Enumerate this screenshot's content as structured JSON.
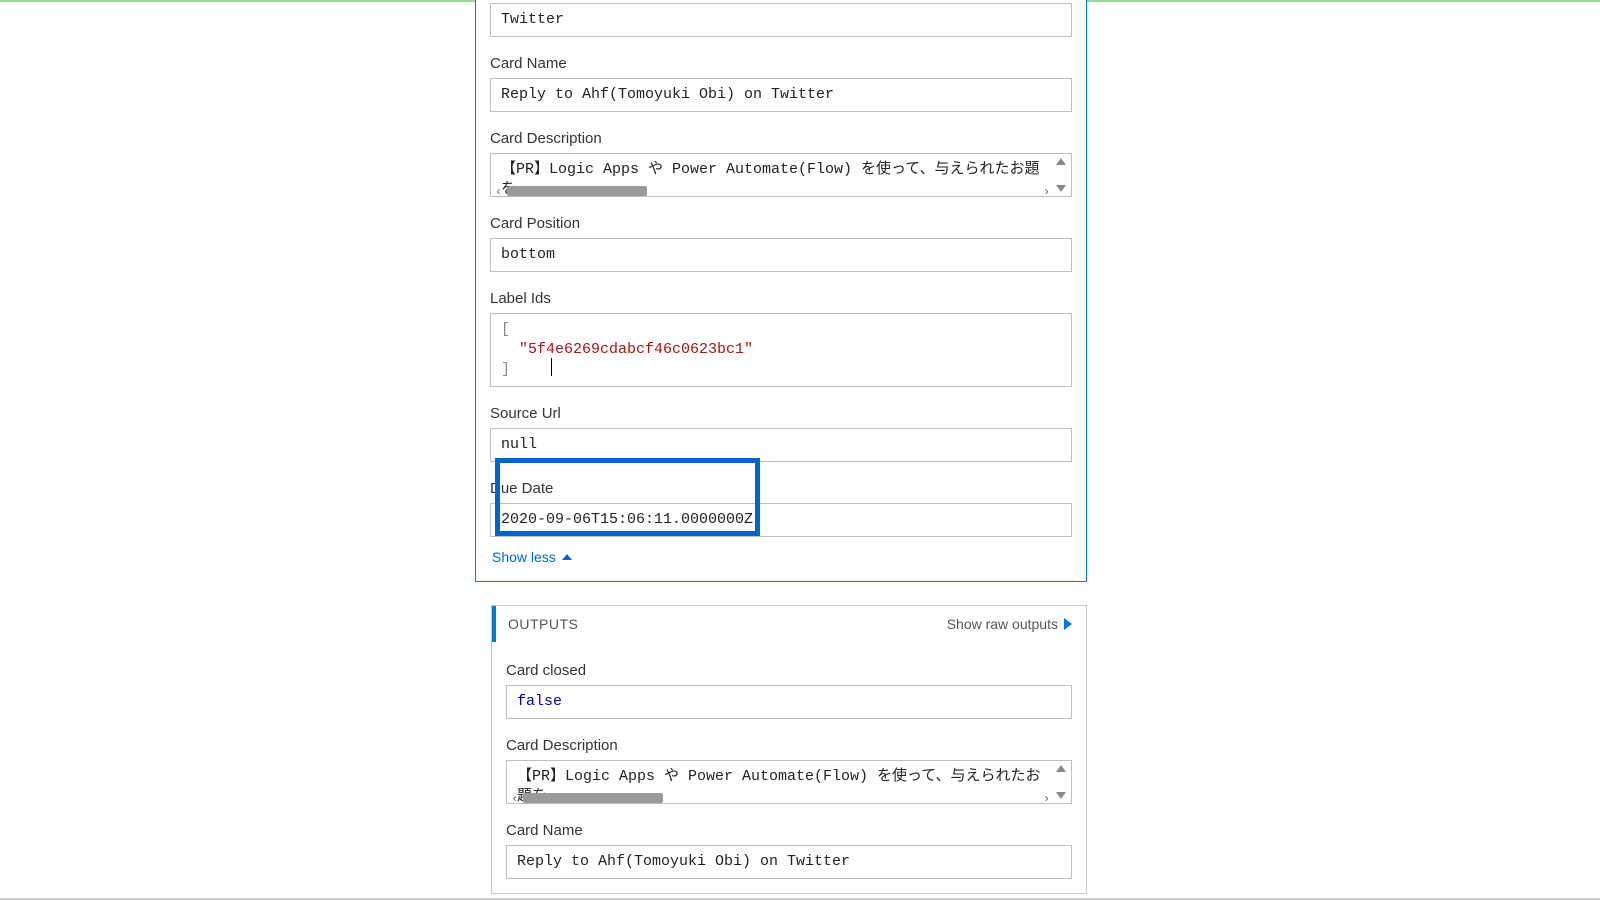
{
  "inputs": {
    "field0_value": "Twitter",
    "card_name_label": "Card Name",
    "card_name_value": "Reply to Ahf(Tomoyuki Obi) on Twitter",
    "card_desc_label": "Card Description",
    "card_desc_value": "【PR】Logic Apps や Power Automate(Flow) を使って、与えられたお題を",
    "card_pos_label": "Card Position",
    "card_pos_value": "bottom",
    "label_ids_label": "Label Ids",
    "label_ids_open": "[",
    "label_ids_item": "\"5f4e6269cdabcf46c0623bc1\"",
    "label_ids_close": "]",
    "source_url_label": "Source Url",
    "source_url_value": "null",
    "due_date_label": "Due Date",
    "due_date_value": "2020-09-06T15:06:11.0000000Z",
    "show_less": "Show less"
  },
  "outputs": {
    "header": "OUTPUTS",
    "raw_link": "Show raw outputs",
    "card_closed_label": "Card closed",
    "card_closed_value": "false",
    "card_desc_label": "Card Description",
    "card_desc_value": "【PR】Logic Apps や Power Automate(Flow) を使って、与えられたお題を",
    "card_name_label": "Card Name",
    "card_name_value": "Reply to Ahf(Tomoyuki Obi) on Twitter"
  }
}
